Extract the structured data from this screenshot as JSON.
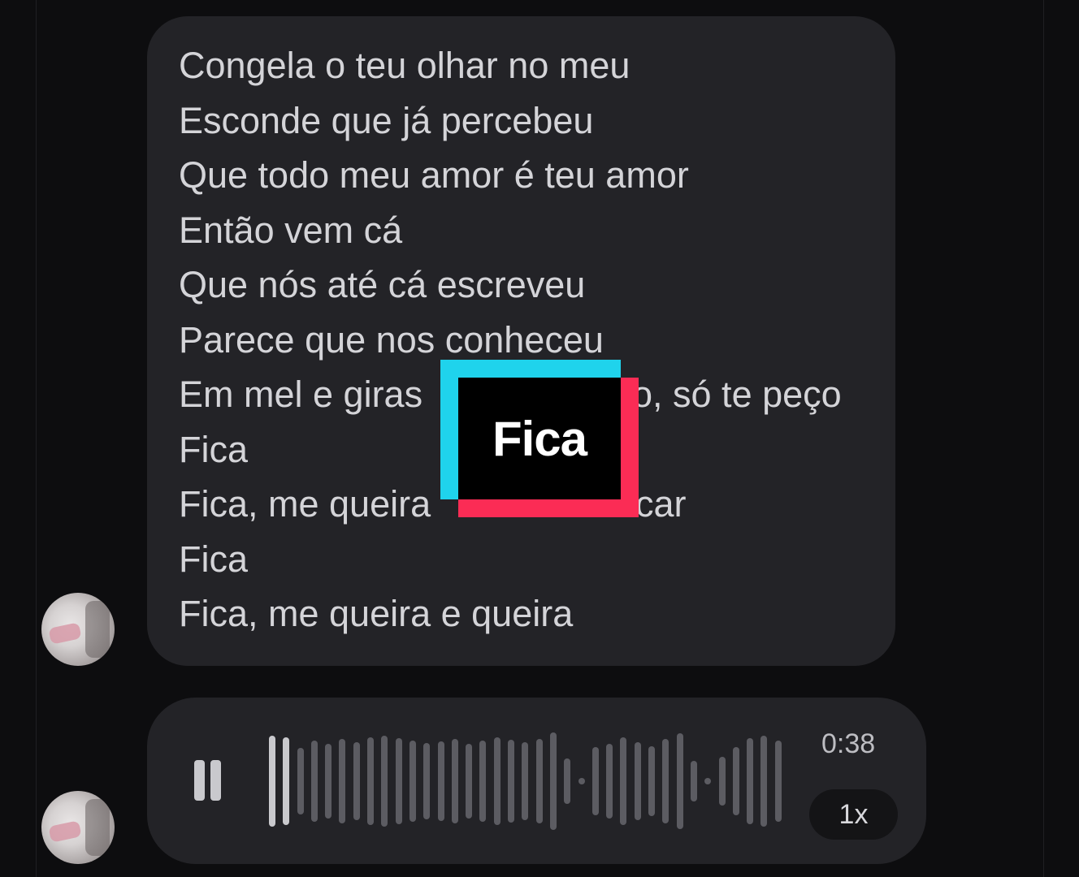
{
  "lyrics": {
    "lines": [
      "Congela o teu olhar no meu",
      "Esconde que já percebeu",
      "Que todo meu amor é teu amor",
      "Então vem cá",
      "Que nós até cá escreveu",
      "Parece que nos conheceu",
      "Em mel e giras",
      "o, só te peço",
      "Fica",
      "Fica, me queira",
      "car",
      "Fica",
      "Fica, me queira e queira"
    ]
  },
  "sticker": {
    "text": "Fica"
  },
  "voice_message": {
    "duration": "0:38",
    "speed": "1x",
    "progress": 0.06,
    "icon": "pause-icon",
    "played_color": "#c9c9cd",
    "unplayed_color": "#5c5c62"
  },
  "colors": {
    "background": "#0d0d0f",
    "bubble": "#232327",
    "text": "#d4d4d8",
    "sticker_cyan": "#1fd3ec",
    "sticker_red": "#fb2c55"
  }
}
